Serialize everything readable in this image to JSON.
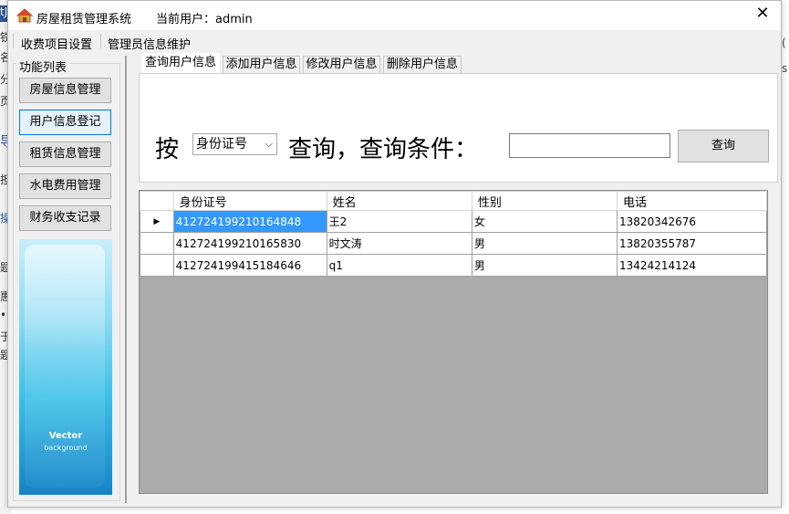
{
  "app": {
    "title": "房屋租赁管理系统",
    "current_user": "当前用户：admin",
    "close": "✕"
  },
  "menu": [
    "收费项目设置",
    "管理员信息维护"
  ],
  "sidebar": {
    "title": "功能列表",
    "buttons": [
      "房屋信息管理",
      "用户信息登记",
      "租赁信息管理",
      "水电费用管理",
      "财务收支记录"
    ],
    "banner_text": "Vector",
    "banner_sub": "background"
  },
  "tabs": [
    "查询用户信息",
    "添加用户信息",
    "修改用户信息",
    "删除用户信息"
  ],
  "search": {
    "prefix": "按",
    "field_value": "身份证号",
    "middle": "查询，查询条件：",
    "input_value": "",
    "button": "查询"
  },
  "table": {
    "columns": [
      "身份证号",
      "姓名",
      "性别",
      "电话"
    ],
    "rows": [
      [
        "412724199210164848",
        "王2",
        "女",
        "13820342676"
      ],
      [
        "412724199210165830",
        "时文涛",
        "男",
        "13820355787"
      ],
      [
        "412724199415184646",
        "q1",
        "男",
        "13424214124"
      ]
    ],
    "row_pointer": "▶"
  },
  "background_window": {
    "left_glyphs": [
      "tJ",
      "铁",
      "名",
      "分",
      "页",
      "导",
      "担",
      "操",
      "题",
      "惠",
      "•",
      "于",
      "题"
    ],
    "right_glyphs": [
      "(",
      "s"
    ]
  }
}
